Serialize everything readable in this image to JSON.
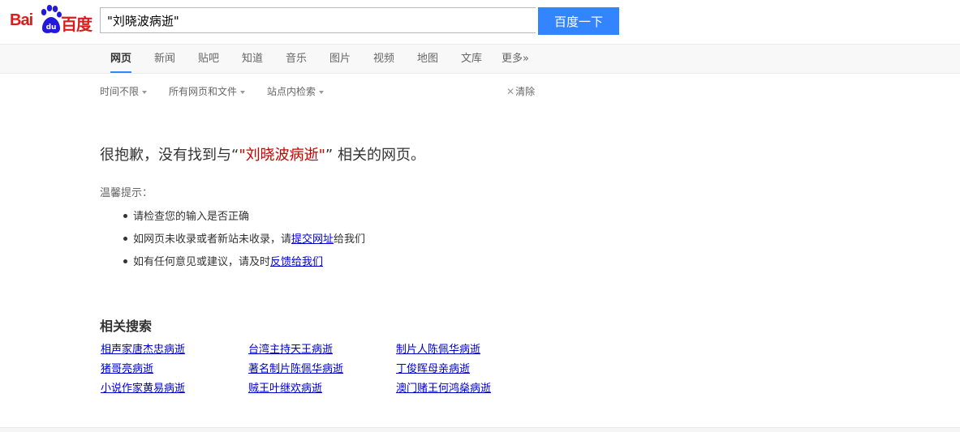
{
  "logo": {
    "bai": "Bai",
    "du": "du",
    "cn": "百度"
  },
  "search": {
    "value": "\"刘晓波病逝\"",
    "button": "百度一下"
  },
  "tabs": [
    {
      "label": "网页",
      "active": true
    },
    {
      "label": "新闻"
    },
    {
      "label": "贴吧"
    },
    {
      "label": "知道"
    },
    {
      "label": "音乐"
    },
    {
      "label": "图片"
    },
    {
      "label": "视频"
    },
    {
      "label": "地图"
    },
    {
      "label": "文库"
    },
    {
      "label": "更多»"
    }
  ],
  "filters": {
    "time": "时间不限",
    "filetype": "所有网页和文件",
    "site": "站点内检索",
    "clear": "清除"
  },
  "message": {
    "prefix": "很抱歉，没有找到与",
    "lquote": "“",
    "query": "\"刘晓波病逝\"",
    "rquote": "”",
    "suffix": "相关的网页。"
  },
  "tips": {
    "title": "温馨提示：",
    "items": [
      {
        "text": "请检查您的输入是否正确"
      },
      {
        "pre": "如网页未收录或者新站未收录，请",
        "link": "提交网址",
        "post": "给我们"
      },
      {
        "pre": "如有任何意见或建议，请及时",
        "link": "反馈给我们"
      }
    ]
  },
  "related": {
    "title": "相关搜索",
    "items": [
      [
        "相声家唐杰忠病逝",
        "台湾主持天王病逝",
        "制片人陈佩华病逝"
      ],
      [
        "猪哥亮病逝",
        "著名制片陈佩华病逝",
        "丁俊晖母亲病逝"
      ],
      [
        "小说作家黄易病逝",
        "贼王叶继欢病逝",
        "澳门赌王何鸿燊病逝"
      ]
    ]
  },
  "colors": {
    "brand_red": "#de1b1b",
    "paw_blue": "#2319dc",
    "button_blue": "#3385ff",
    "link": "#0000cc",
    "query_red": "#cc0000"
  }
}
